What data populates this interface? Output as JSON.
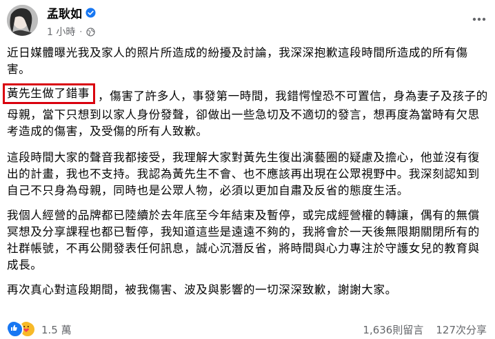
{
  "post": {
    "author": "孟耿如",
    "time": "1 小時",
    "dot": "·",
    "paragraphs": {
      "p1": "近日媒體曝光我及家人的照片所造成的紛擾及討論，我深深抱歉這段時間所造成的所有傷害。",
      "p2_highlight": "黃先生做了錯事",
      "p2_rest": "，傷害了許多人，事發第一時間，我錯愕惶恐不可置信，身為妻子及孩子的母親，當下只想到以家人身份發聲，卻做出一些急切及不適切的發言，想再度為當時有欠思考造成的傷害，及受傷的所有人致歉。",
      "p3": "這段時間大家的聲音我都接受，我理解大家對黃先生復出演藝圈的疑慮及擔心，他並沒有復出的計畫，我也不支持。我認為黃先生不會、也不應該再出現在公眾視野中。我深刻認知到自己不只身為母親，同時也是公眾人物，必須以更加自肅及反省的態度生活。",
      "p4": "我個人經營的品牌都已陸續於去年底至今年結束及暫停，或完成經營權的轉讓，偶有的無償冥想及分享課程也都已暫停，我知道這些是遠遠不夠的，我將會於一天後無限期關閉所有的社群帳號，不再公開發表任何訊息，誠心沉潛反省，將時間與心力專注於守護女兒的教育與成長。",
      "p5": "再次真心對這段期間，被我傷害、波及與影響的一切深深致歉，謝謝大家。"
    },
    "reactions": {
      "count": "1.5 萬",
      "like_color": "#1877f2",
      "care_color": "#f7b928"
    },
    "comments": "1,636則留言",
    "shares": "127次分享",
    "highlight_color": "#d9000d"
  }
}
